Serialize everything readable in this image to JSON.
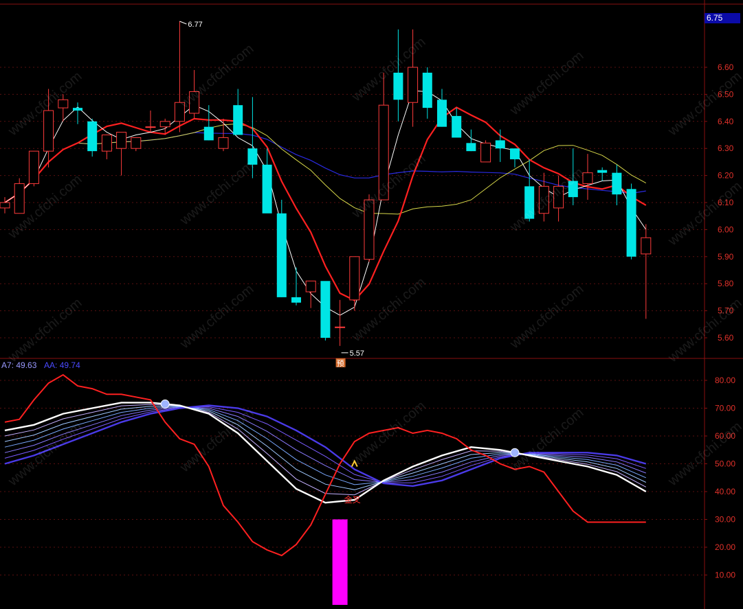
{
  "watermark": "www.cfchi.com",
  "price_panel": {
    "current_price": "6.75",
    "high_label": "6.77",
    "low_label": "5.57",
    "signal_label": "预",
    "y_ticks": [
      "6.60",
      "6.50",
      "6.40",
      "6.30",
      "6.20",
      "6.10",
      "6.00",
      "5.90",
      "5.80",
      "5.70",
      "5.60"
    ]
  },
  "indicator_panel": {
    "legend": [
      {
        "text": "A7: 49.63",
        "color": "#9a9aff"
      },
      {
        "text": "AA: 49.74",
        "color": "#4a4aff"
      }
    ],
    "cross_label": "金叉",
    "y_ticks": [
      "80.00",
      "70.00",
      "60.00",
      "50.00",
      "40.00",
      "30.00",
      "20.00",
      "10.00"
    ]
  },
  "colors": {
    "up": "#ff3b3b",
    "down": "#00e5e5",
    "ma_white": "#ffffff",
    "ma_red": "#ff2020",
    "ma_yellow": "#d8d84a",
    "ma_blue": "#2a2ae0",
    "axis": "#8a1010",
    "grid": "#5a1010",
    "bar": "#ff00ff"
  },
  "chart_data": [
    {
      "type": "candlestick",
      "x": [
        1,
        2,
        3,
        4,
        5,
        6,
        7,
        8,
        9,
        10,
        11,
        12,
        13,
        14,
        15,
        16,
        17,
        18,
        19,
        20,
        21,
        22,
        23,
        24,
        25,
        26,
        27,
        28,
        29,
        30,
        31,
        32,
        33,
        34,
        35,
        36,
        37,
        38,
        39,
        40,
        41,
        42,
        43,
        44,
        45
      ],
      "open": [
        6.08,
        6.06,
        6.17,
        6.29,
        6.45,
        6.45,
        6.4,
        6.29,
        6.3,
        6.3,
        6.38,
        6.38,
        6.4,
        6.43,
        6.38,
        6.3,
        6.46,
        6.3,
        6.24,
        6.06,
        5.75,
        5.77,
        5.81,
        5.64,
        5.74,
        5.89,
        6.11,
        6.58,
        6.47,
        6.58,
        6.48,
        6.42,
        6.32,
        6.25,
        6.33,
        6.3,
        6.16,
        6.06,
        6.08,
        6.18,
        6.17,
        6.22,
        6.21,
        6.15,
        5.91
      ],
      "high": [
        6.12,
        6.19,
        6.29,
        6.52,
        6.5,
        6.47,
        6.41,
        6.35,
        6.34,
        6.33,
        6.44,
        6.41,
        6.77,
        6.59,
        6.46,
        6.41,
        6.52,
        6.49,
        6.3,
        6.11,
        5.86,
        5.79,
        5.8,
        5.74,
        5.9,
        6.13,
        6.58,
        6.74,
        6.74,
        6.6,
        6.52,
        6.45,
        6.37,
        6.33,
        6.37,
        6.3,
        6.26,
        6.21,
        6.2,
        6.3,
        6.28,
        6.23,
        6.24,
        6.17,
        6.02
      ],
      "low": [
        6.06,
        6.08,
        6.16,
        6.23,
        6.4,
        6.39,
        6.27,
        6.26,
        6.2,
        6.29,
        6.36,
        6.35,
        6.36,
        6.41,
        6.33,
        6.29,
        6.35,
        6.19,
        6.1,
        5.75,
        5.72,
        5.71,
        5.59,
        5.57,
        5.7,
        5.88,
        6.11,
        6.4,
        6.38,
        6.41,
        6.38,
        6.36,
        6.29,
        6.25,
        6.25,
        6.23,
        6.03,
        6.03,
        6.03,
        6.09,
        6.11,
        6.18,
        6.09,
        5.89,
        5.67
      ],
      "close": [
        6.1,
        6.17,
        6.29,
        6.44,
        6.48,
        6.44,
        6.29,
        6.35,
        6.36,
        6.34,
        6.38,
        6.4,
        6.47,
        6.51,
        6.33,
        6.34,
        6.35,
        6.24,
        6.06,
        5.75,
        5.73,
        5.81,
        5.6,
        5.64,
        5.9,
        6.11,
        6.46,
        6.48,
        6.6,
        6.45,
        6.38,
        6.34,
        6.29,
        6.32,
        6.3,
        6.26,
        6.04,
        6.16,
        6.16,
        6.12,
        6.21,
        6.21,
        6.13,
        5.9,
        5.97
      ]
    },
    {
      "type": "line",
      "name": "A7",
      "x": [
        1,
        3,
        5,
        7,
        9,
        11,
        13,
        15,
        17,
        19,
        21,
        23,
        25,
        27,
        29,
        31,
        33,
        35,
        37,
        39,
        41,
        43,
        45
      ],
      "values": [
        62,
        64,
        68,
        70,
        72,
        72,
        71,
        68,
        61,
        51,
        41,
        36,
        37,
        44,
        49,
        53,
        56,
        55,
        53,
        51,
        49,
        46,
        40
      ]
    },
    {
      "type": "line",
      "name": "AA",
      "x": [
        1,
        3,
        5,
        7,
        9,
        11,
        13,
        15,
        17,
        19,
        21,
        23,
        25,
        27,
        29,
        31,
        33,
        35,
        37,
        39,
        41,
        43,
        45
      ],
      "values": [
        50,
        53,
        57,
        61,
        65,
        68,
        70,
        71,
        70,
        67,
        62,
        56,
        48,
        43,
        42,
        44,
        48,
        52,
        54,
        54,
        54,
        53,
        50
      ]
    },
    {
      "type": "line",
      "name": "RSI",
      "x": [
        1,
        2,
        3,
        4,
        5,
        6,
        7,
        8,
        9,
        10,
        11,
        12,
        13,
        14,
        15,
        16,
        17,
        18,
        19,
        20,
        21,
        22,
        23,
        24,
        25,
        26,
        27,
        28,
        29,
        30,
        31,
        32,
        33,
        34,
        35,
        36,
        37,
        38,
        39,
        40,
        41,
        42,
        43,
        44,
        45
      ],
      "values": [
        65,
        66,
        73,
        79,
        82,
        78,
        77,
        75,
        75,
        74,
        73,
        65,
        59,
        57,
        49,
        35,
        29,
        22,
        19,
        17,
        21,
        28,
        39,
        50,
        58,
        61,
        62,
        63,
        61,
        62,
        61,
        59,
        55,
        53,
        50,
        48,
        49,
        47,
        40,
        33,
        29,
        29,
        29,
        29,
        29
      ]
    },
    {
      "type": "bar",
      "name": "signal",
      "x": [
        24
      ],
      "values": [
        30
      ]
    }
  ]
}
